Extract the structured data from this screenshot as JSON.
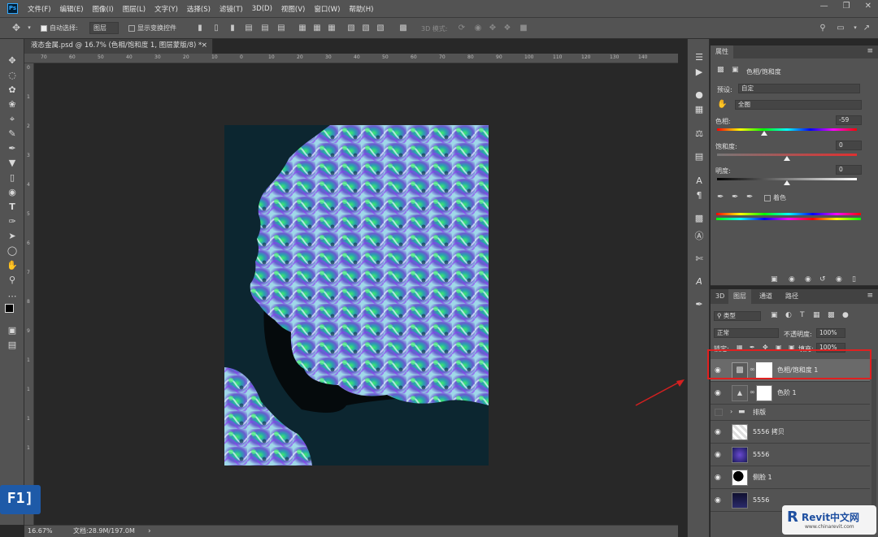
{
  "app": {
    "logo": "Ps"
  },
  "menu": [
    "文件(F)",
    "编辑(E)",
    "图像(I)",
    "图层(L)",
    "文字(Y)",
    "选择(S)",
    "滤镜(T)",
    "3D(D)",
    "视图(V)",
    "窗口(W)",
    "帮助(H)"
  ],
  "options": {
    "auto_select_label": "自动选择:",
    "auto_select_value": "图层",
    "show_transform_label": "显示变换控件",
    "mode_3d_label": "3D 模式:"
  },
  "document": {
    "tab_title": "液态金属.psd @ 16.7% (色相/饱和度 1, 图层蒙版/8) *",
    "zoom": "16.67%",
    "doc_size": "文档:28.9M/197.0M"
  },
  "ruler_top": [
    "70",
    "60",
    "50",
    "40",
    "30",
    "20",
    "10",
    "0",
    "10",
    "20",
    "30",
    "40",
    "50",
    "60",
    "70",
    "80",
    "90",
    "100",
    "110",
    "120",
    "130",
    "140"
  ],
  "ruler_left": [
    "0",
    "1",
    "2",
    "3",
    "4",
    "5",
    "6",
    "7",
    "8",
    "9",
    "1",
    "1",
    "1",
    "1"
  ],
  "properties": {
    "tab": "属性",
    "title": "色相/饱和度",
    "preset_label": "预设:",
    "preset_value": "自定",
    "channel_value": "全图",
    "hue_label": "色相:",
    "hue_value": "-59",
    "hue": -59,
    "saturation_label": "饱和度:",
    "saturation_value": "0",
    "saturation": 0,
    "lightness_label": "明度:",
    "lightness_value": "0",
    "lightness": 0,
    "colorize_label": "着色"
  },
  "layers_panel": {
    "tabs": [
      "3D",
      "图层",
      "通道",
      "路径"
    ],
    "kind_label": "类型",
    "blend_mode": "正常",
    "opacity_label": "不透明度:",
    "opacity_value": "100%",
    "lock_label": "锁定:",
    "fill_label": "填充:",
    "fill_value": "100%",
    "layers": [
      {
        "name": "色相/饱和度 1",
        "visible": true,
        "selected": true
      },
      {
        "name": "色阶 1",
        "visible": true,
        "selected": false
      },
      {
        "name": "排版",
        "visible": false,
        "selected": false
      },
      {
        "name": "5556 拷贝",
        "visible": true,
        "selected": false
      },
      {
        "name": "5556",
        "visible": true,
        "selected": false
      },
      {
        "name": "侧脸 1",
        "visible": true,
        "selected": false
      },
      {
        "name": "5556",
        "visible": true,
        "selected": false
      }
    ]
  },
  "badge": {
    "text": "F1]"
  },
  "watermark": {
    "brand": "Revit中文网",
    "url": "www.chinarevit.com"
  },
  "colors": {
    "panel": "#535353",
    "canvas": "#282828",
    "highlight_box": "#e02020",
    "ps_blue": "#31a8ff"
  }
}
